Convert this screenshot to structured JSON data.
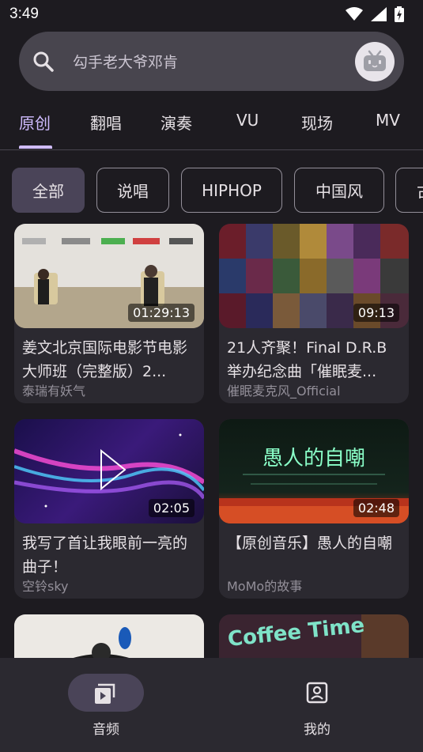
{
  "status_bar": {
    "time": "3:49"
  },
  "search": {
    "placeholder": "勾手老大爷邓肯"
  },
  "tabs": [
    "原创",
    "翻唱",
    "演奏",
    "VU",
    "现场",
    "MV"
  ],
  "chips": [
    "全部",
    "说唱",
    "HIPHOP",
    "中国风",
    "古"
  ],
  "cards": [
    {
      "title": "姜文北京国际电影节电影大师班（完整版）2...",
      "author": "泰瑞有妖气",
      "duration": "01:29:13"
    },
    {
      "title": "21人齐聚！Final D.R.B举办纪念曲「催眠麦...",
      "author": "催眠麦克风_Official",
      "duration": "09:13"
    },
    {
      "title": "我写了首让我眼前一亮的曲子！",
      "author": "空铃sky",
      "duration": "02:05"
    },
    {
      "title": "【原创音乐】愚人的自嘲",
      "author": "MoMo的故事",
      "duration": "02:48"
    },
    {
      "title": "",
      "author": "",
      "duration": ""
    },
    {
      "title": "",
      "author": "",
      "duration": ""
    }
  ],
  "thumb_text": {
    "card3": "愚人的自嘲",
    "card5": "Coffee Time"
  },
  "bottom_nav": {
    "items": [
      "音频",
      "我的"
    ]
  },
  "colors": {
    "accent": "#d0bcff",
    "background": "#1d1b20",
    "surface": "#2b2930",
    "chip_active": "#4a4458"
  }
}
